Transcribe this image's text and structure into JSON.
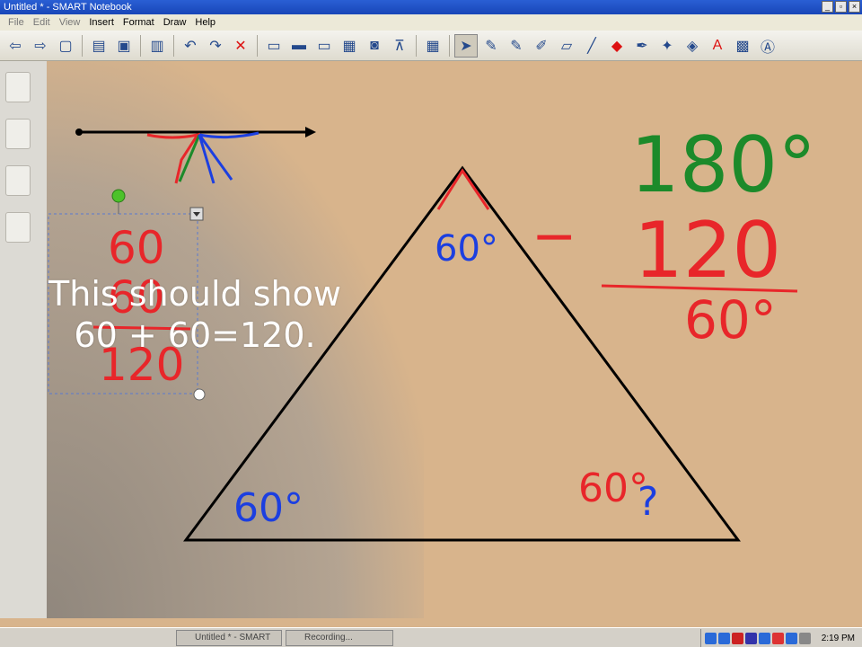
{
  "window": {
    "title": "Untitled * - SMART Notebook",
    "btn_min": "_",
    "btn_max": "▫",
    "btn_close": "×"
  },
  "menu": [
    "File",
    "Edit",
    "View",
    "Insert",
    "Format",
    "Draw",
    "Help"
  ],
  "toolbar": {
    "icons": [
      "back-icon",
      "forward-icon",
      "page-icon",
      "open-icon",
      "save-icon",
      "paste-icon",
      "undo-icon",
      "redo-icon",
      "delete-icon",
      "screen-shade-icon",
      "display-icon",
      "monitor-icon",
      "record-icon",
      "camera-icon",
      "doc-camera-icon",
      "table-icon",
      "select-icon",
      "pen-icon",
      "creative-pen-icon",
      "highlighter-icon",
      "eraser-icon",
      "line-icon",
      "shapes-icon",
      "magic-pen-icon",
      "shape-recognition-icon",
      "fill-icon",
      "text-icon",
      "properties-icon",
      "more-icon"
    ]
  },
  "caption": {
    "line1": "This should show",
    "line2": "60 + 60=120."
  },
  "whiteboard": {
    "angle_top": "60°",
    "angle_left": "60°",
    "angle_right": "60°",
    "question_mark": "?",
    "sum_top": "60",
    "sum_mid": "60",
    "sum_result": "120",
    "calc_minuend": "180°",
    "calc_minus": "−",
    "calc_subtrahend": "120",
    "calc_result": "60°"
  },
  "taskbar": {
    "tasks": [
      "Untitled * - SMART No...",
      "Recording..."
    ],
    "clock": "2:19 PM"
  },
  "colors": {
    "red": "#e8262a",
    "blue": "#1c3fe0",
    "green": "#1c8a2a",
    "canvas": "#d8b48c"
  }
}
